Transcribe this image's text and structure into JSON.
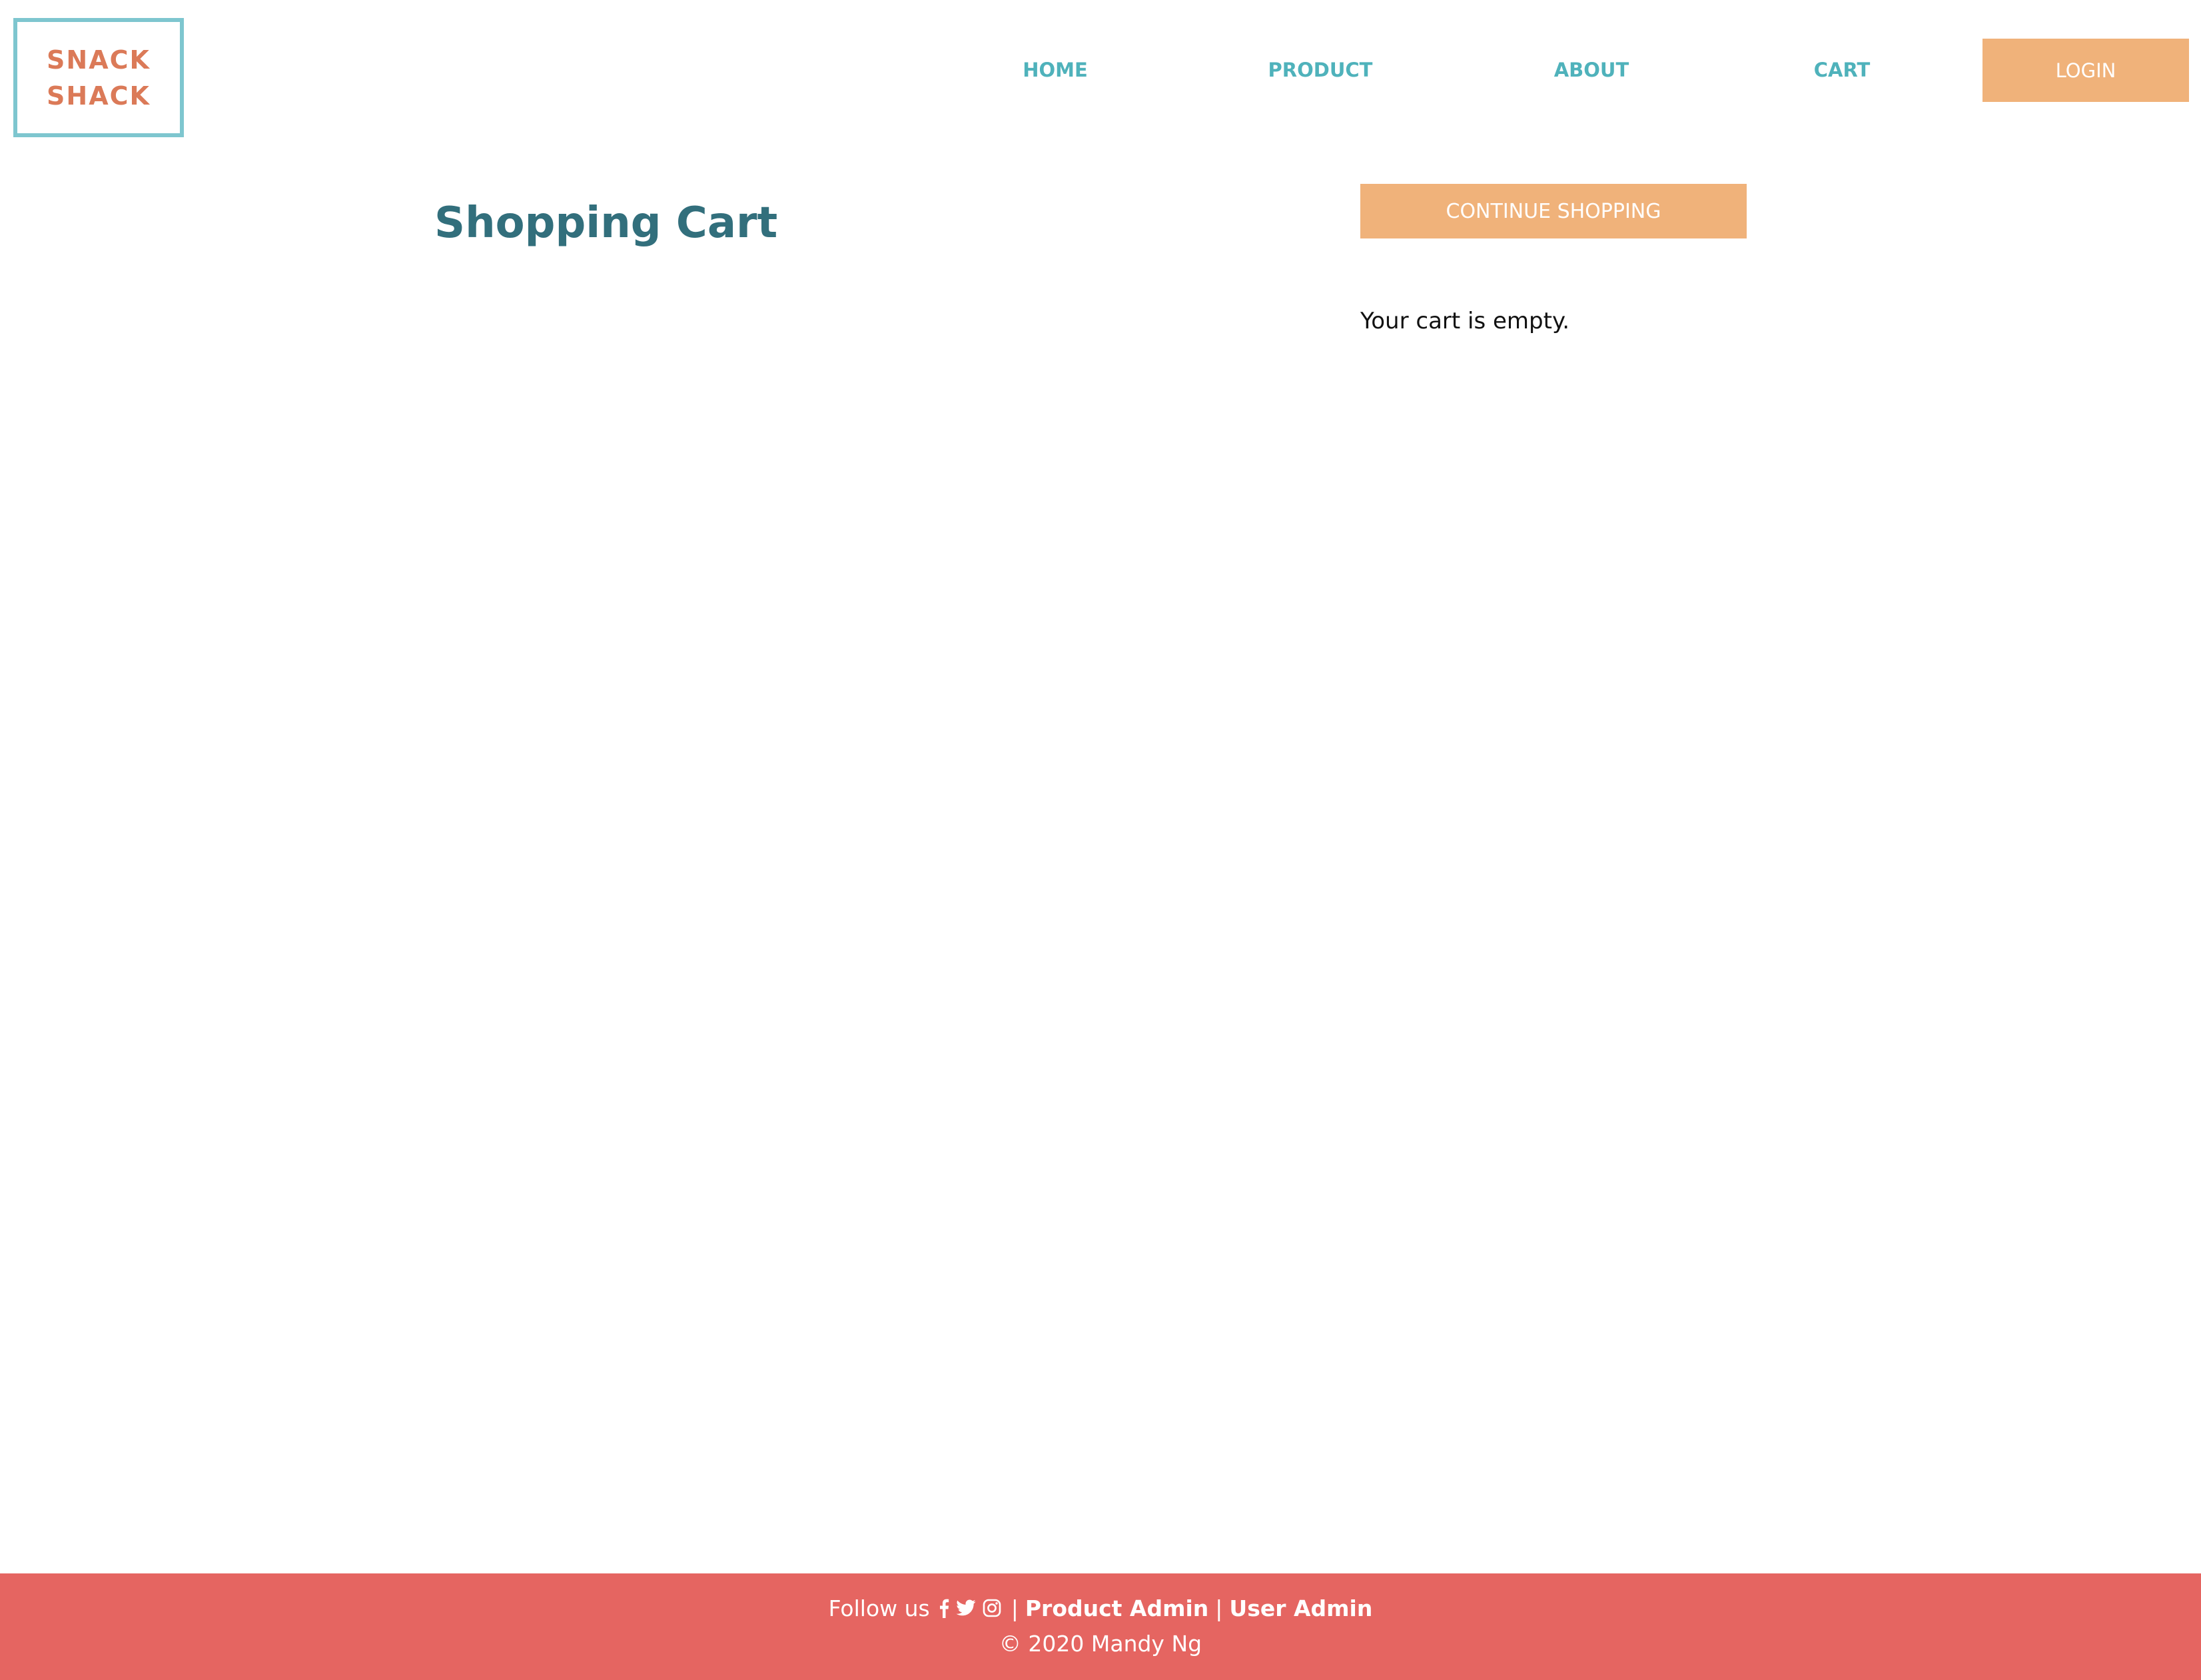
{
  "header": {
    "logo": {
      "line1": "SNACK",
      "line2": "SHACK"
    },
    "nav": {
      "home": "HOME",
      "product": "PRODUCT",
      "about": "ABOUT",
      "cart": "CART"
    },
    "login_label": "LOGIN"
  },
  "main": {
    "title": "Shopping Cart",
    "continue_label": "CONTINUE SHOPPING",
    "empty_message": "Your cart is empty."
  },
  "footer": {
    "follow_label": "Follow us",
    "separator": "|",
    "icons": [
      "facebook-icon",
      "twitter-icon",
      "instagram-icon"
    ],
    "product_admin": "Product Admin",
    "user_admin": "User Admin",
    "copyright": "© 2020 Mandy Ng"
  },
  "colors": {
    "teal_nav": "#4fb2bb",
    "teal_dark": "#326f7c",
    "logo_border": "#7ec6cf",
    "logo_text": "#db7a58",
    "button": "#f0b27a",
    "footer": "#e56561"
  }
}
